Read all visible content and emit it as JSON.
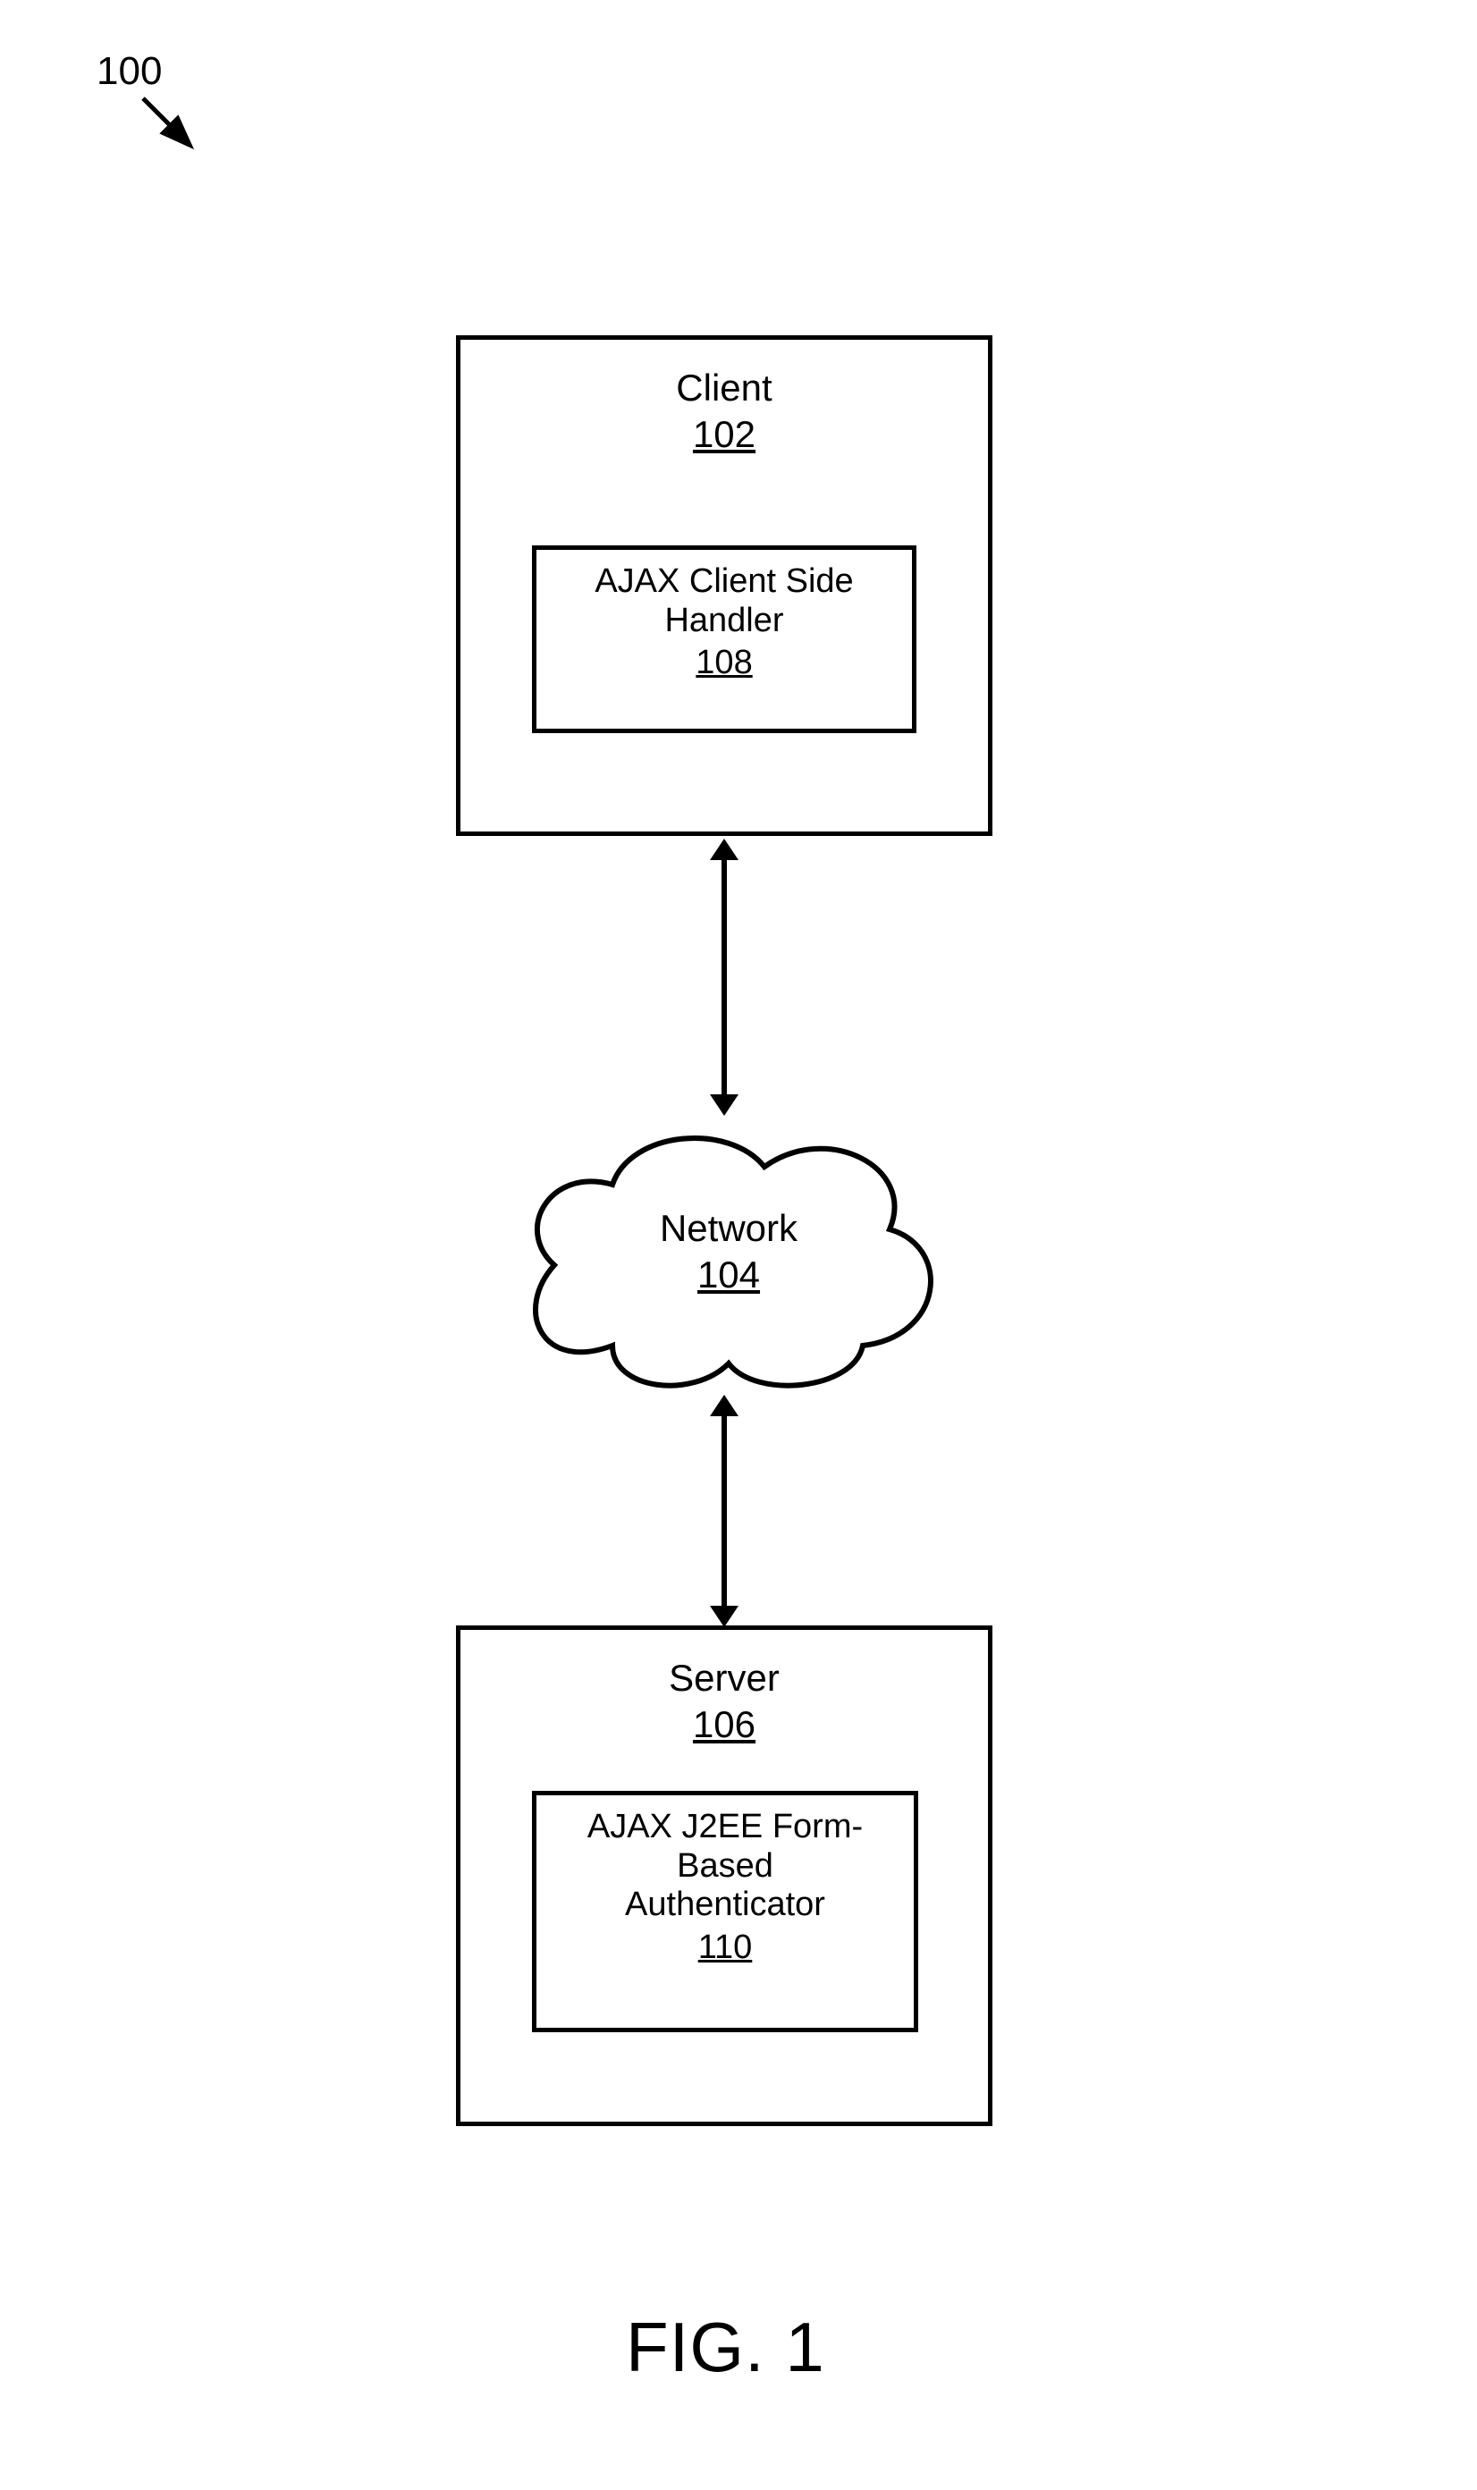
{
  "figure_ref": "100",
  "client": {
    "title": "Client",
    "num": "102",
    "handler_title_l1": "AJAX Client Side",
    "handler_title_l2": "Handler",
    "handler_num": "108"
  },
  "network": {
    "title": "Network",
    "num": "104"
  },
  "server": {
    "title": "Server",
    "num": "106",
    "auth_title_l1": "AJAX J2EE Form-",
    "auth_title_l2": "Based",
    "auth_title_l3": "Authenticator",
    "auth_num": "110"
  },
  "caption": "FIG. 1"
}
